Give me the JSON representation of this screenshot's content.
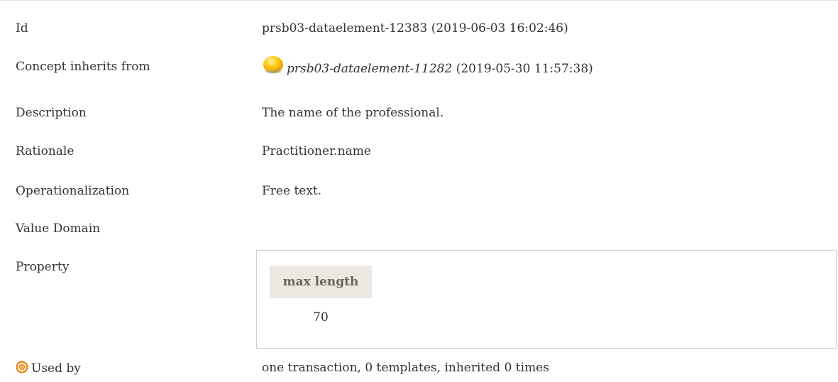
{
  "rows": {
    "id": {
      "label": "Id",
      "value": "prsb03-dataelement-12383 (2019-06-03 16:02:46)"
    },
    "concept_inherits": {
      "label": "Concept inherits from",
      "icon": "yellow-orb-icon",
      "link": "prsb03-dataelement-11282",
      "suffix": "(2019-05-30 11:57:38)"
    },
    "description": {
      "label": "Description",
      "value": "The name of the professional."
    },
    "rationale": {
      "label": "Rationale",
      "value": "Practitioner.name"
    },
    "operationalization": {
      "label": "Operationalization",
      "value": "Free text."
    },
    "value_domain": {
      "label": "Value Domain"
    },
    "property": {
      "label": "Property",
      "header": "max length",
      "value": "70"
    },
    "used_by": {
      "icon": "target-icon",
      "label": "Used by",
      "value": "one transaction, 0 templates, inherited 0 times"
    }
  },
  "colors": {
    "text": "#333333",
    "orb": "#f5b800",
    "target_icon": "#ef7d00",
    "header_bg": "#ebe7e1",
    "header_text": "#6b6459",
    "border": "#cfcfcf"
  }
}
